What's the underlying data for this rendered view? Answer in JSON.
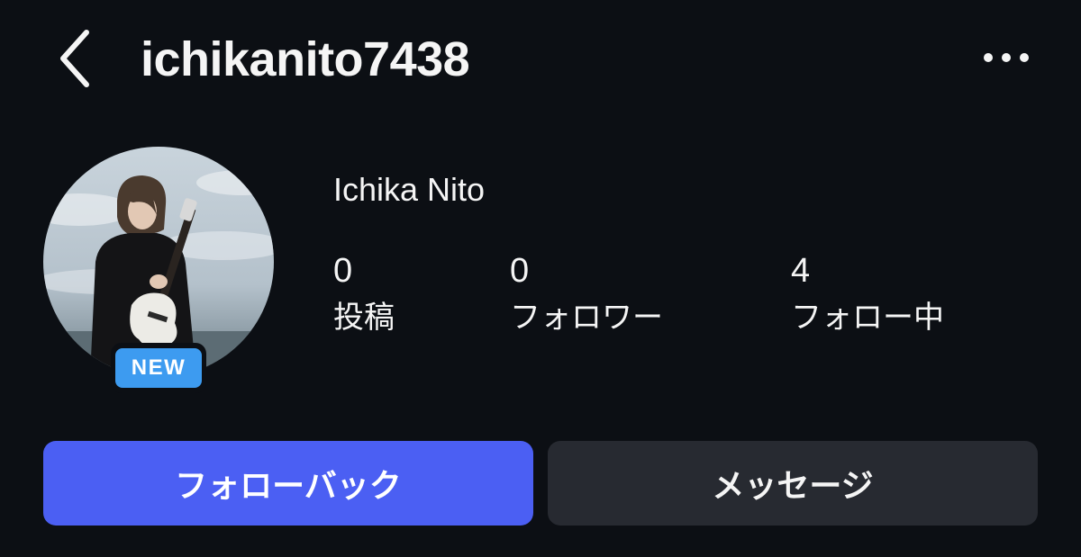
{
  "header": {
    "back_icon": "chevron-left-icon",
    "username": "ichikanito7438",
    "more_icon": "more-horizontal-icon"
  },
  "profile": {
    "display_name": "Ichika Nito",
    "avatar": "profile-photo-person-with-guitar",
    "badge": "NEW",
    "badge_color": "#3d9bf0"
  },
  "stats": [
    {
      "value": "0",
      "label": "投稿"
    },
    {
      "value": "0",
      "label": "フォロワー"
    },
    {
      "value": "4",
      "label": "フォロー中"
    }
  ],
  "actions": {
    "follow_back_label": "フォローバック",
    "message_label": "メッセージ",
    "follow_back_color": "#4b5ff3",
    "message_color": "#272a31"
  },
  "theme": {
    "background": "#0c0f14",
    "text": "#f5f5f5"
  }
}
